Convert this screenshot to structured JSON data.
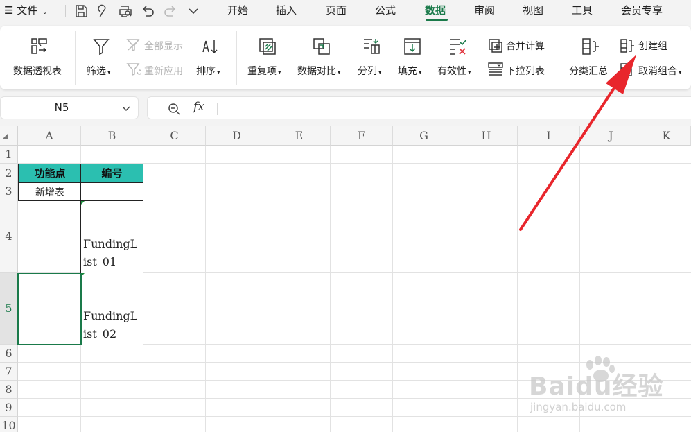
{
  "menubar": {
    "file_label": "文件",
    "tabs": [
      "开始",
      "插入",
      "页面",
      "公式",
      "数据",
      "审阅",
      "视图",
      "工具",
      "会员专享"
    ],
    "active_tab": "数据"
  },
  "ribbon": {
    "pivot": "数据透视表",
    "filter": "筛选",
    "show_all": "全部显示",
    "reapply": "重新应用",
    "sort": "排序",
    "duplicates": "重复项",
    "compare": "数据对比",
    "split": "分列",
    "fill": "填充",
    "validity": "有效性",
    "consolidate": "合并计算",
    "dropdown_list": "下拉列表",
    "subtotal": "分类汇总",
    "create_group": "创建组",
    "ungroup": "取消组合"
  },
  "formula": {
    "cell_ref": "N5",
    "fx": "fx",
    "value": ""
  },
  "sheet": {
    "columns": [
      "A",
      "B",
      "C",
      "D",
      "E",
      "F",
      "G",
      "H",
      "I",
      "J",
      "K"
    ],
    "rows": [
      "1",
      "2",
      "3",
      "4",
      "5",
      "6",
      "7",
      "8",
      "9",
      "10"
    ],
    "header_a": "功能点",
    "header_b": "编号",
    "a3": "新增表",
    "b4_line1": "FundingL",
    "b4_line2": "ist_01",
    "b5_line1": "FundingL",
    "b5_line2": "ist_02"
  },
  "colors": {
    "accent": "#1a7a4a",
    "header_fill": "#2bbfb0",
    "arrow": "#e8262c"
  },
  "watermark": {
    "brand": "Baidu经验",
    "url": "jingyan.baidu.com"
  }
}
